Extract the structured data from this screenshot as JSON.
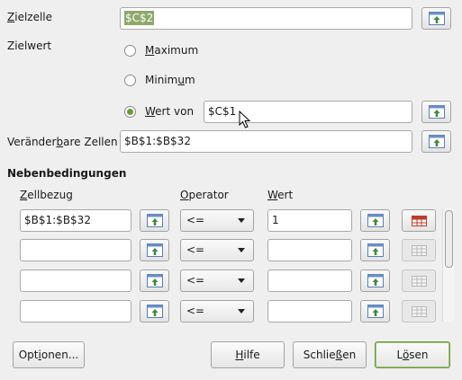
{
  "target_cell": {
    "label_pre": "",
    "label_u": "Z",
    "label_post": "ielzelle",
    "value": "$C$2"
  },
  "target_value": {
    "label": "Zielwert",
    "options": [
      {
        "pre": "",
        "u": "M",
        "post": "aximum",
        "selected": false
      },
      {
        "pre": "Minim",
        "u": "u",
        "post": "m",
        "selected": false
      },
      {
        "pre": "",
        "u": "W",
        "post": "ert von",
        "selected": true
      }
    ],
    "value_of": "$C$1"
  },
  "changing_cells": {
    "label_pre": "Veränder",
    "label_u": "b",
    "label_post": "are Zellen",
    "value": "$B$1:$B$32"
  },
  "constraints": {
    "title": "Nebenbedingungen",
    "headers": {
      "cell_ref": {
        "pre": "",
        "u": "Z",
        "post": "ellbezug"
      },
      "operator": {
        "pre": "",
        "u": "O",
        "post": "perator"
      },
      "value": {
        "pre": "",
        "u": "W",
        "post": "ert"
      }
    },
    "rows": [
      {
        "cell_ref": "$B$1:$B$32",
        "operator": "<=",
        "value": "1",
        "delete_enabled": true
      },
      {
        "cell_ref": "",
        "operator": "<=",
        "value": "",
        "delete_enabled": false
      },
      {
        "cell_ref": "",
        "operator": "<=",
        "value": "",
        "delete_enabled": false
      },
      {
        "cell_ref": "",
        "operator": "<=",
        "value": "",
        "delete_enabled": false
      }
    ]
  },
  "buttons": {
    "options": {
      "pre": "Opt",
      "u": "i",
      "post": "onen..."
    },
    "help": {
      "pre": "",
      "u": "H",
      "post": "ilfe"
    },
    "close": {
      "pre": "Schlie",
      "u": "ß",
      "post": "en"
    },
    "solve": {
      "pre": "L",
      "u": "ö",
      "post": "sen"
    }
  },
  "colors": {
    "selection": "#8ea86b",
    "radio_selected": "#6a9a3a",
    "delete_icon": "#c0392b"
  }
}
